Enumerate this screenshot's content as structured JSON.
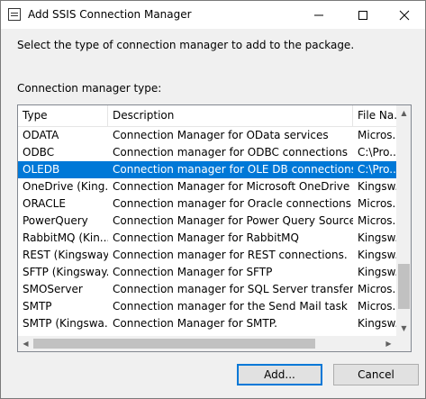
{
  "window": {
    "title": "Add SSIS Connection Manager"
  },
  "instructions": "Select the type of connection manager to add to the package.",
  "list_label": "Connection manager type:",
  "columns": {
    "type": "Type",
    "description": "Description",
    "file": "File Na..."
  },
  "rows": [
    {
      "type": "ODATA",
      "description": "Connection Manager for OData services",
      "file": "Micros..."
    },
    {
      "type": "ODBC",
      "description": "Connection manager for ODBC connections",
      "file": "C:\\Pro..."
    },
    {
      "type": "OLEDB",
      "description": "Connection manager for OLE DB connections",
      "file": "C:\\Pro...",
      "selected": true
    },
    {
      "type": "OneDrive (King...",
      "description": "Connection Manager for Microsoft OneDrive",
      "file": "Kingsw..."
    },
    {
      "type": "ORACLE",
      "description": "Connection manager for Oracle connections",
      "file": "Micros..."
    },
    {
      "type": "PowerQuery",
      "description": "Connection Manager for Power Query Source",
      "file": "Micros..."
    },
    {
      "type": "RabbitMQ (Kin...",
      "description": "Connection Manager for RabbitMQ",
      "file": "Kingsw..."
    },
    {
      "type": "REST (Kingsway...",
      "description": "Connection manager for REST connections.",
      "file": "Kingsw..."
    },
    {
      "type": "SFTP (Kingsway...",
      "description": "Connection Manager for SFTP",
      "file": "Kingsw..."
    },
    {
      "type": "SMOServer",
      "description": "Connection manager for SQL Server transfer ta...",
      "file": "Micros..."
    },
    {
      "type": "SMTP",
      "description": "Connection manager for the Send Mail task",
      "file": "Micros..."
    },
    {
      "type": "SMTP (Kingswa...",
      "description": "Connection Manager for SMTP.",
      "file": "Kingsw..."
    }
  ],
  "buttons": {
    "add": "Add...",
    "cancel": "Cancel"
  },
  "colors": {
    "selection": "#0078d7",
    "dialog_bg": "#f0f0f0"
  }
}
